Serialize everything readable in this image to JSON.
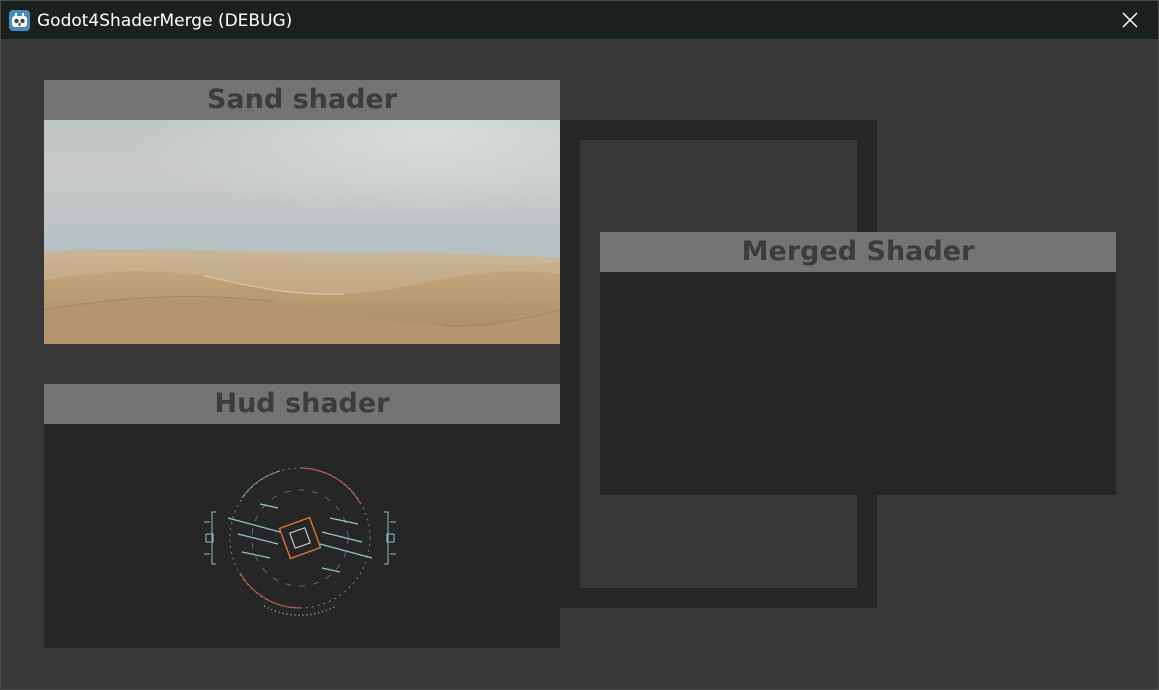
{
  "window": {
    "title": "Godot4ShaderMerge (DEBUG)",
    "icon": "godot-icon",
    "close_icon": "close-icon"
  },
  "panels": {
    "sand": {
      "title": "Sand shader",
      "content": "desert-dunes-render"
    },
    "hud": {
      "title": "Hud shader",
      "content": "hud-reticle-render"
    },
    "merged": {
      "title": "Merged Shader",
      "content": "empty"
    }
  },
  "colors": {
    "titlebar": "#1a211d",
    "background": "#383838",
    "panel_body": "#262626",
    "panel_header": "#747474",
    "panel_header_text": "#3c3c3c",
    "hud_cyan": "#9fd7e3",
    "hud_red": "#c0655a",
    "hud_orange": "#d9753f"
  }
}
